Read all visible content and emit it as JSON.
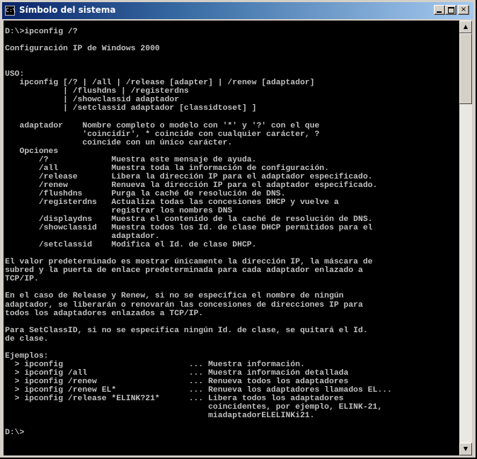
{
  "window": {
    "title": "Símbolo del sistema",
    "icon": "C:\\",
    "buttons": {
      "minimize": "minimize-icon",
      "maximize": "maximize-icon",
      "close": "×"
    }
  },
  "console": {
    "lines": [
      "D:\\>ipconfig /?",
      "",
      "Configuración IP de Windows 2000",
      "",
      "",
      "USO:",
      "   ipconfig [/? | /all | /release [adapter] | /renew [adaptador]",
      "            | /flushdns | /registerdns",
      "            | /showclassid adaptador",
      "            | /setclassid adaptador [classidtoset] ]",
      "",
      "   adaptador    Nombre completo o modelo con '*' y '?' con el que",
      "                'coincidir', * coincide con cualquier carácter, ?",
      "                coincide con un único carácter.",
      "   Opciones",
      "       /?             Muestra este mensaje de ayuda.",
      "       /all           Muestra toda la información de configuración.",
      "       /release       Libera la dirección IP para el adaptador especificado.",
      "       /renew         Renueva la dirección IP para el adaptador especificado.",
      "       /flushdns      Purga la caché de resolución de DNS.",
      "       /registerdns   Actualiza todas las concesiones DHCP y vuelve a",
      "                      registrar los nombres DNS",
      "       /displaydns    Muestra el contenido de la caché de resolución de DNS.",
      "       /showclassid   Muestra todos los Id. de clase DHCP permitidos para el",
      "                      adaptador.",
      "       /setclassid    Modifica el Id. de clase DHCP.",
      "",
      "El valor predeterminado es mostrar únicamente la dirección IP, la máscara de",
      "subred y la puerta de enlace predeterminada para cada adaptador enlazado a",
      "TCP/IP.",
      "",
      "En el caso de Release y Renew, si no se especifica el nombre de ningún",
      "adaptador, se liberarán o renovarán las concesiones de direcciones IP para",
      "todos los adaptadores enlazados a TCP/IP.",
      "",
      "Para SetClassID, si no se especifica ningún Id. de clase, se quitará el Id.",
      "de clase.",
      "",
      "Ejemplos:",
      "  > ipconfig                          ... Muestra información.",
      "  > ipconfig /all                     ... Muestra información detallada",
      "  > ipconfig /renew                   ... Renueva todos los adaptadores",
      "  > ipconfig /renew EL*               ... Renueva los adaptadores llamados EL...",
      "  > ipconfig /release *ELINK?21*      ... Libera todos los adaptadores",
      "                                          coincidentes, por ejemplo, ELINK-21,",
      "                                          miadaptadorELELINKi21.",
      "",
      "D:\\>"
    ]
  },
  "scrollbar": {
    "up_icon": "▲",
    "down_icon": "▼"
  }
}
